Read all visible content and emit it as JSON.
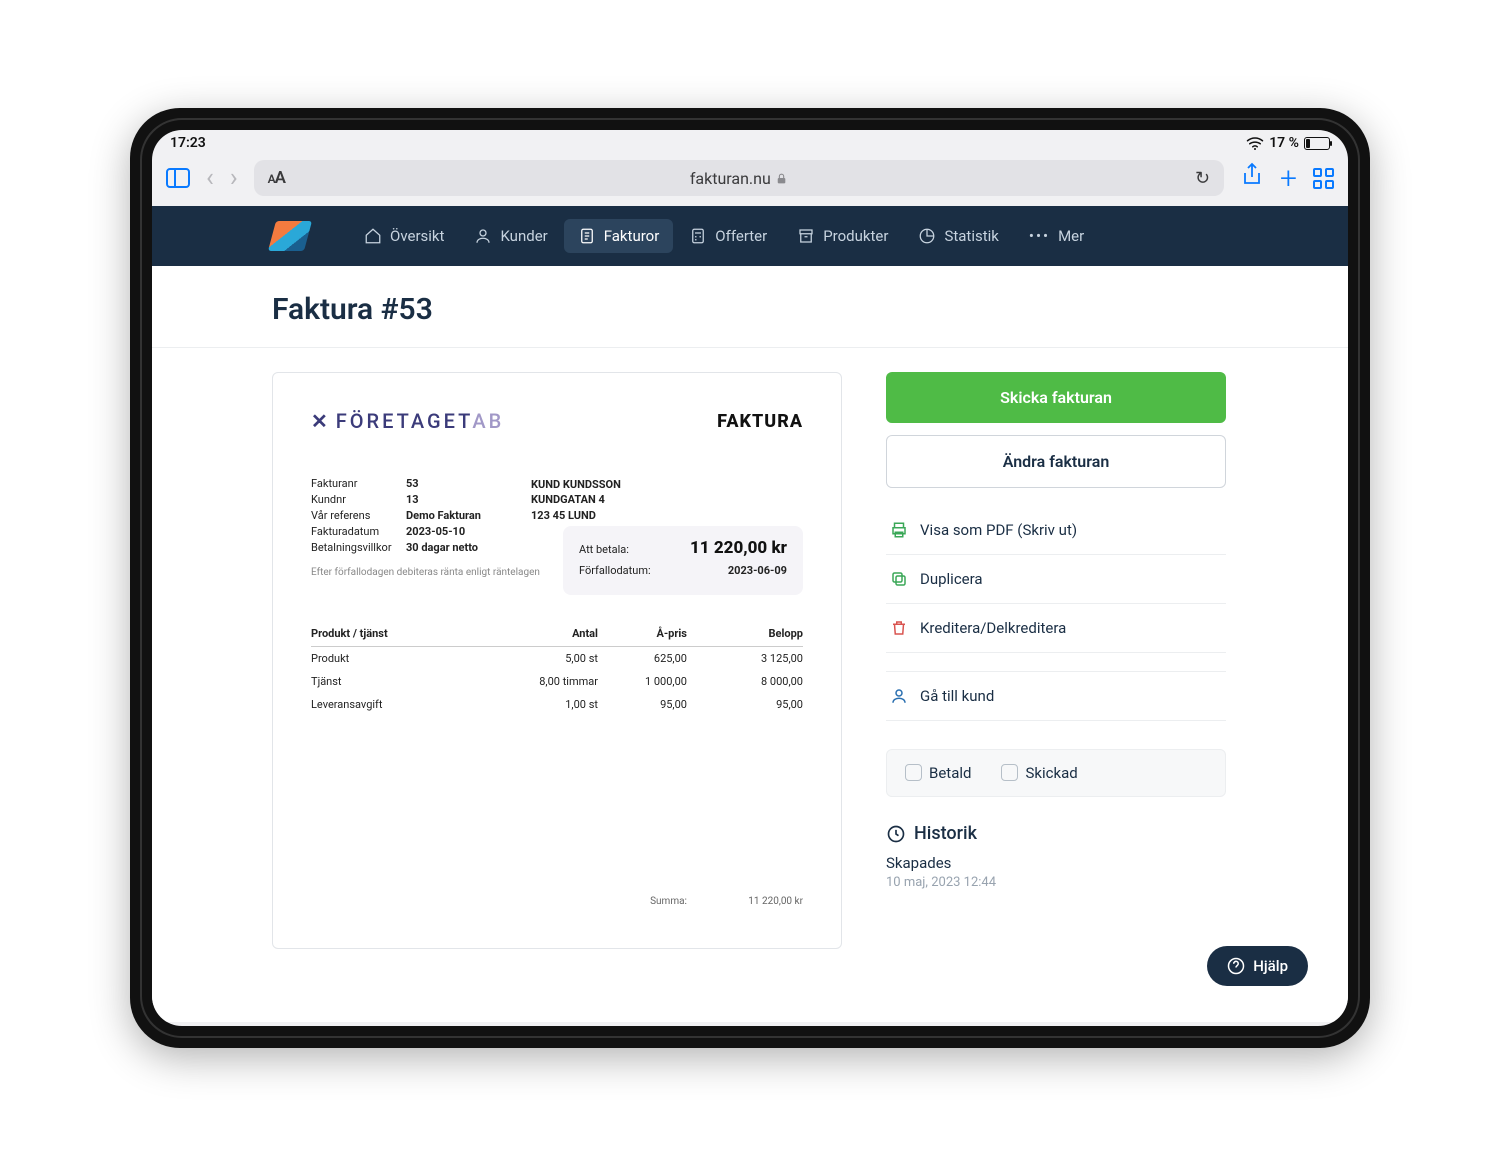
{
  "status": {
    "time": "17:23",
    "battery": "17 %"
  },
  "browser": {
    "url": "fakturan.nu",
    "aa": "AA"
  },
  "nav": {
    "items": [
      {
        "label": "Översikt"
      },
      {
        "label": "Kunder"
      },
      {
        "label": "Fakturor"
      },
      {
        "label": "Offerter"
      },
      {
        "label": "Produkter"
      },
      {
        "label": "Statistik"
      },
      {
        "label": "Mer"
      }
    ]
  },
  "page": {
    "title": "Faktura #53"
  },
  "invoice": {
    "company": "FÖRETAGET",
    "company_suffix": "AB",
    "doc_type": "FAKTURA",
    "meta": {
      "fakturanr_lbl": "Fakturanr",
      "fakturanr": "53",
      "kundnr_lbl": "Kundnr",
      "kundnr": "13",
      "ref_lbl": "Vår referens",
      "ref": "Demo Fakturan",
      "date_lbl": "Fakturadatum",
      "date": "2023-05-10",
      "terms_lbl": "Betalningsvillkor",
      "terms": "30 dagar netto"
    },
    "customer": {
      "name": "KUND KUNDSSON",
      "street": "KUNDGATAN 4",
      "city": "123 45 LUND"
    },
    "interest_note": "Efter förfallodagen debiteras ränta enligt räntelagen",
    "pay": {
      "to_pay_lbl": "Att betala:",
      "amount": "11 220,00 kr",
      "due_lbl": "Förfallodatum:",
      "due": "2023-06-09"
    },
    "columns": {
      "prod": "Produkt / tjänst",
      "qty": "Antal",
      "price": "Å-pris",
      "amount": "Belopp"
    },
    "lines": [
      {
        "name": "Produkt",
        "qty": "5,00 st",
        "price": "625,00",
        "amount": "3 125,00"
      },
      {
        "name": "Tjänst",
        "qty": "8,00 timmar",
        "price": "1 000,00",
        "amount": "8 000,00"
      },
      {
        "name": "Leveransavgift",
        "qty": "1,00 st",
        "price": "95,00",
        "amount": "95,00"
      }
    ],
    "sum_lbl": "Summa:",
    "sum": "11 220,00 kr"
  },
  "side": {
    "send": "Skicka fakturan",
    "edit": "Ändra fakturan",
    "actions": {
      "pdf": "Visa som PDF (Skriv ut)",
      "dup": "Duplicera",
      "credit": "Kreditera/Delkreditera",
      "goto": "Gå till kund"
    },
    "paid": "Betald",
    "sent": "Skickad",
    "history_title": "Historik",
    "history": {
      "label": "Skapades",
      "time": "10 maj, 2023 12:44"
    }
  },
  "help": "Hjälp"
}
